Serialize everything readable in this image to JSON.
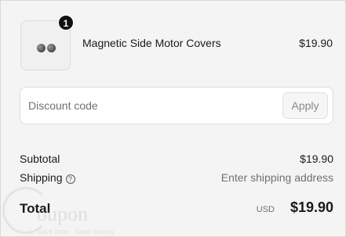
{
  "line_item": {
    "quantity": "1",
    "name": "Magnetic Side Motor Covers",
    "price": "$19.90",
    "image_icon": "product-thumbnail"
  },
  "discount": {
    "placeholder": "Discount code",
    "value": "",
    "apply_label": "Apply"
  },
  "summary": {
    "subtotal_label": "Subtotal",
    "subtotal_value": "$19.90",
    "shipping_label": "Shipping",
    "shipping_help_icon": "question-circle-icon",
    "shipping_value": "Enter shipping address",
    "total_label": "Total",
    "currency": "USD",
    "total_value": "$19.90"
  },
  "watermark": {
    "brand": "oupon",
    "tagline": "Save time · Save money"
  }
}
